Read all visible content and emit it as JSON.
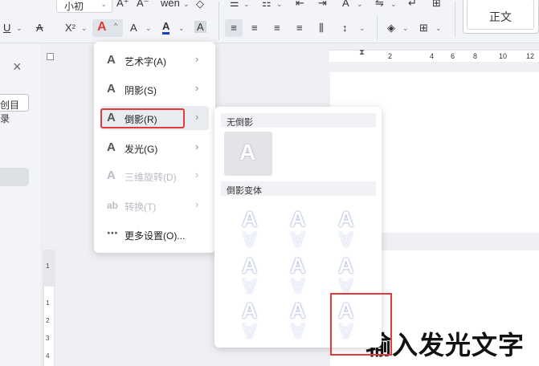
{
  "ribbon": {
    "font_size": "小初",
    "style_name": "正文",
    "row1_icons": [
      "increase-font-icon",
      "decrease-font-icon",
      "phonetic-icon",
      "eraser-icon",
      "bullets-icon",
      "numbering-icon",
      "indent-decrease-icon",
      "indent-increase-icon",
      "text-direction-icon",
      "sort-icon",
      "show-marks-icon",
      "border-icon"
    ],
    "row1_labels": {
      "increase": "A⁺",
      "decrease": "A⁻",
      "phonetic": "wén",
      "eraser": "◇"
    },
    "row2_labels": {
      "underline": "U",
      "strikethrough": "A",
      "superscript": "X²",
      "art_text": "A",
      "highlight": "A",
      "font_color": "A",
      "char_shade": "A"
    }
  },
  "left_panel": {
    "close_glyph": "×",
    "toc_button": "创目录"
  },
  "hruler": {
    "ticks": [
      "2",
      "4",
      "6",
      "8",
      "10",
      "12"
    ]
  },
  "vruler": {
    "ticks": [
      "1",
      "1",
      "2",
      "3",
      "4"
    ]
  },
  "menu": {
    "items": [
      {
        "label": "艺术字(A)",
        "icon": "art-text-icon",
        "has_submenu": true,
        "enabled": true
      },
      {
        "label": "阴影(S)",
        "icon": "shadow-icon",
        "has_submenu": true,
        "enabled": true
      },
      {
        "label": "倒影(R)",
        "icon": "reflection-icon",
        "has_submenu": true,
        "enabled": true,
        "active": true
      },
      {
        "label": "发光(G)",
        "icon": "glow-icon",
        "has_submenu": true,
        "enabled": true
      },
      {
        "label": "三维旋转(D)",
        "icon": "3d-rotation-icon",
        "has_submenu": true,
        "enabled": false
      },
      {
        "label": "转换(T)",
        "icon": "transform-icon",
        "has_submenu": true,
        "enabled": false
      },
      {
        "label": "更多设置(O)...",
        "icon": "more-icon",
        "has_submenu": false,
        "enabled": true
      }
    ]
  },
  "submenu": {
    "section_none": "无倒影",
    "section_variants": "倒影变体",
    "glyph": "A"
  },
  "document": {
    "text": "输入发光文字"
  },
  "colors": {
    "accent_red": "#e23b3b",
    "art_icon": "#e03636",
    "font_color_bar": "#1a3fbf",
    "reflection_blue": "#7f93c9"
  }
}
